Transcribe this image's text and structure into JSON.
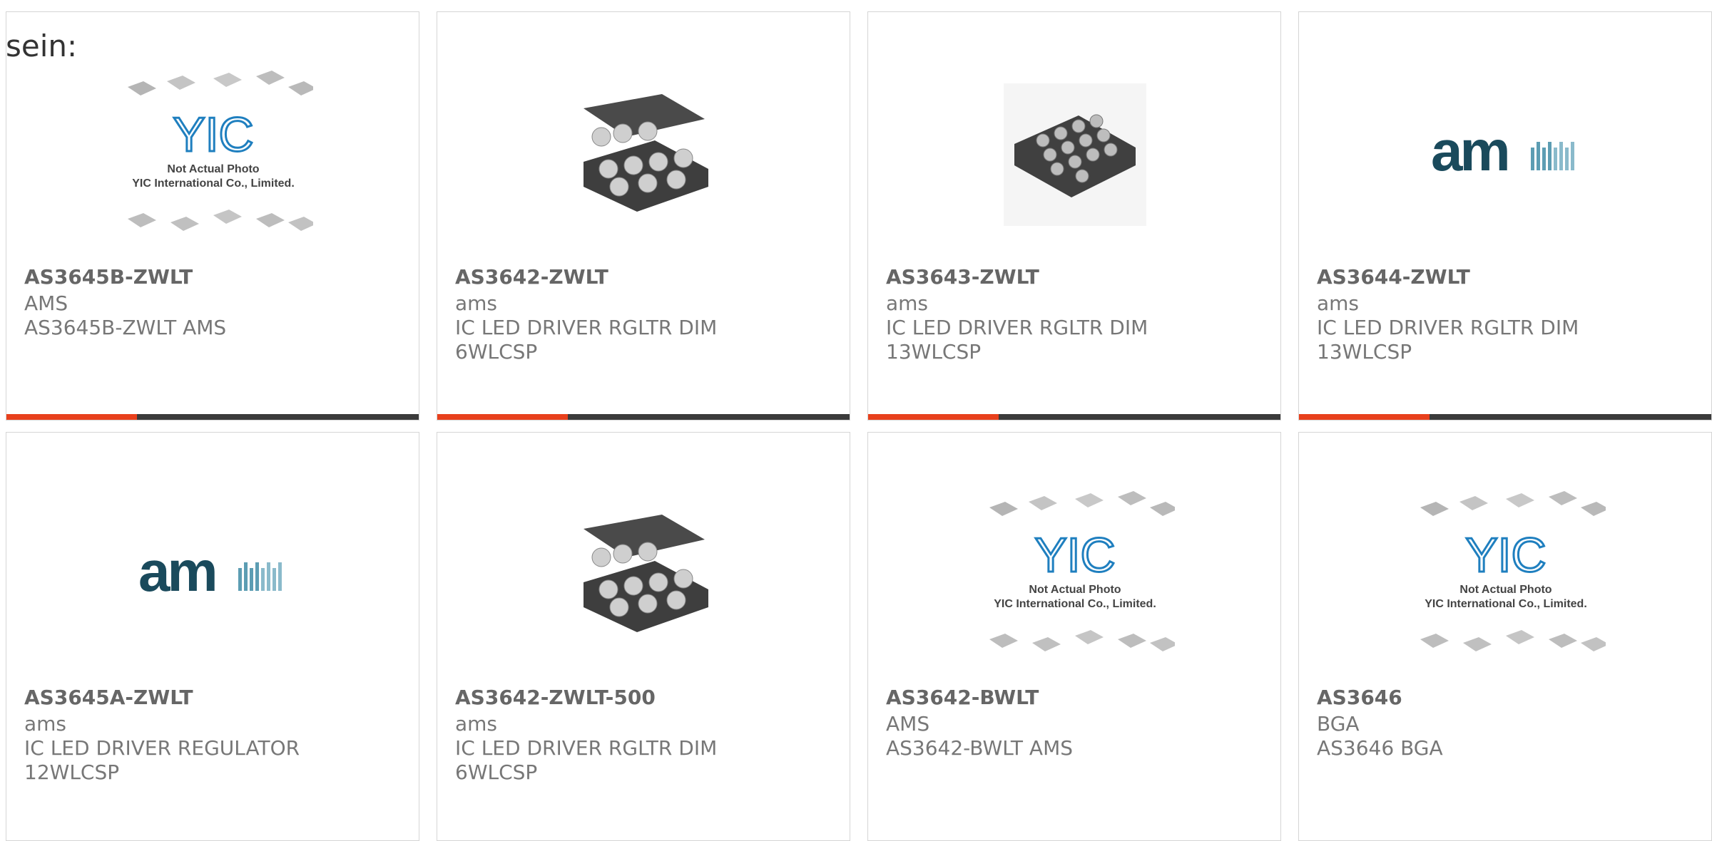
{
  "page": {
    "heading": "sein:"
  },
  "products": [
    {
      "name": "AS3645B-ZWLT",
      "manufacturer": "AMS",
      "description_lines": [
        "AS3645B-ZWLT AMS"
      ],
      "image": "placeholder-yic",
      "image_caption": "Not Actual Photo",
      "image_company": "YIC International Co., Limited."
    },
    {
      "name": "AS3642-ZWLT",
      "manufacturer": "ams",
      "description_lines": [
        "IC LED DRIVER RGLTR DIM",
        "6WLCSP"
      ],
      "image": "wlcsp-6-chip"
    },
    {
      "name": "AS3643-ZWLT",
      "manufacturer": "ams",
      "description_lines": [
        "IC LED DRIVER RGLTR DIM",
        "13WLCSP"
      ],
      "image": "wlcsp-13-chip"
    },
    {
      "name": "AS3644-ZWLT",
      "manufacturer": "ams",
      "description_lines": [
        "IC LED DRIVER RGLTR DIM",
        "13WLCSP"
      ],
      "image": "ams-logo"
    },
    {
      "name": "AS3645A-ZWLT",
      "manufacturer": "ams",
      "description_lines": [
        "IC LED DRIVER REGULATOR",
        "12WLCSP"
      ],
      "image": "ams-logo"
    },
    {
      "name": "AS3642-ZWLT-500",
      "manufacturer": "ams",
      "description_lines": [
        "IC LED DRIVER RGLTR DIM",
        "6WLCSP"
      ],
      "image": "wlcsp-6-chip"
    },
    {
      "name": "AS3642-BWLT",
      "manufacturer": "AMS",
      "description_lines": [
        "AS3642-BWLT AMS"
      ],
      "image": "placeholder-yic",
      "image_caption": "Not Actual Photo",
      "image_company": "YIC International Co., Limited."
    },
    {
      "name": "AS3646",
      "manufacturer": "BGA",
      "description_lines": [
        "AS3646 BGA"
      ],
      "image": "placeholder-yic",
      "image_caption": "Not Actual Photo",
      "image_company": "YIC International Co., Limited."
    }
  ],
  "colors": {
    "accent": "#e8401c",
    "bar": "#3b3b3b",
    "ams_logo": "#1a4a5c"
  }
}
